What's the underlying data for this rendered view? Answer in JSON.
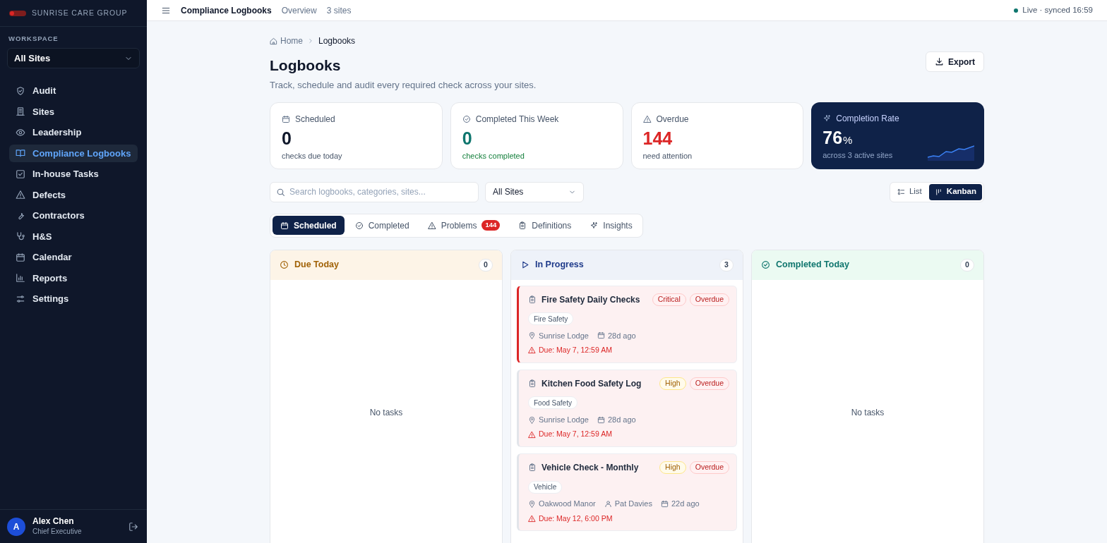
{
  "sidebar": {
    "org_name": "SUNRISE CARE GROUP",
    "workspace_label": "WORKSPACE",
    "workspace_select": "All Sites",
    "items": [
      {
        "label": "Audit",
        "selected": false
      },
      {
        "label": "Sites",
        "selected": false
      },
      {
        "label": "Leadership",
        "selected": false
      },
      {
        "label": "Compliance Logbooks",
        "selected": true
      },
      {
        "label": "In-house Tasks",
        "selected": false
      },
      {
        "label": "Defects",
        "selected": false
      },
      {
        "label": "Contractors",
        "selected": false
      },
      {
        "label": "H&S",
        "selected": false
      },
      {
        "label": "Calendar",
        "selected": false
      },
      {
        "label": "Reports",
        "selected": false
      },
      {
        "label": "Settings",
        "selected": false
      }
    ],
    "user": {
      "initial": "A",
      "name": "Alex Chen",
      "role": "Chief Executive"
    }
  },
  "topbar": {
    "title": "Compliance Logbooks",
    "crumbs": [
      "Overview",
      "3 sites"
    ],
    "status": "Live · synced 16:59"
  },
  "breadcrumb": {
    "home": "Home",
    "current": "Logbooks"
  },
  "page": {
    "title": "Logbooks",
    "subtitle": "Track, schedule and audit every required check across your sites.",
    "export_button": "Export"
  },
  "stats": [
    {
      "kind": "scheduled",
      "label": "Scheduled",
      "value": "0",
      "caption": "checks due today"
    },
    {
      "kind": "completed",
      "label": "Completed This Week",
      "value": "0",
      "caption": "checks completed"
    },
    {
      "kind": "overdue",
      "label": "Overdue",
      "value": "144",
      "caption": "need attention"
    },
    {
      "kind": "rate",
      "label": "Completion Rate",
      "value": "76",
      "unit": "%",
      "caption": "across 3 active sites"
    }
  ],
  "filters": {
    "search_placeholder": "Search logbooks, categories, sites...",
    "site_select": "All Sites"
  },
  "views": [
    {
      "label": "List",
      "selected": false
    },
    {
      "label": "Kanban",
      "selected": true
    }
  ],
  "tabs": [
    {
      "label": "Scheduled",
      "selected": true
    },
    {
      "label": "Completed",
      "selected": false
    },
    {
      "label": "Problems",
      "selected": false,
      "badge": "144"
    },
    {
      "label": "Definitions",
      "selected": false
    },
    {
      "label": "Insights",
      "selected": false
    }
  ],
  "columns": [
    {
      "kind": "due",
      "title": "Due Today",
      "count": "0",
      "empty_text": "No tasks"
    },
    {
      "kind": "progress",
      "title": "In Progress",
      "count": "3",
      "cards": [
        {
          "title": "Fire Safety Daily Checks",
          "flagged": true,
          "badges": [
            {
              "kind": "critical",
              "label": "Critical"
            },
            {
              "kind": "overdue",
              "label": "Overdue"
            }
          ],
          "category": "Fire Safety",
          "site": "Sunrise Lodge",
          "age": "28d ago",
          "due": "Due: May 7, 12:59 AM"
        },
        {
          "title": "Kitchen Food Safety Log",
          "flagged": false,
          "badges": [
            {
              "kind": "high",
              "label": "High"
            },
            {
              "kind": "overdue",
              "label": "Overdue"
            }
          ],
          "category": "Food Safety",
          "site": "Sunrise Lodge",
          "age": "28d ago",
          "due": "Due: May 7, 12:59 AM"
        },
        {
          "title": "Vehicle Check - Monthly",
          "flagged": false,
          "badges": [
            {
              "kind": "high",
              "label": "High"
            },
            {
              "kind": "overdue",
              "label": "Overdue"
            }
          ],
          "category": "Vehicle",
          "site": "Oakwood Manor",
          "assignee": "Pat Davies",
          "age": "22d ago",
          "due": "Due: May 12, 6:00 PM"
        }
      ]
    },
    {
      "kind": "completed",
      "title": "Completed Today",
      "count": "0",
      "empty_text": "No tasks"
    }
  ]
}
